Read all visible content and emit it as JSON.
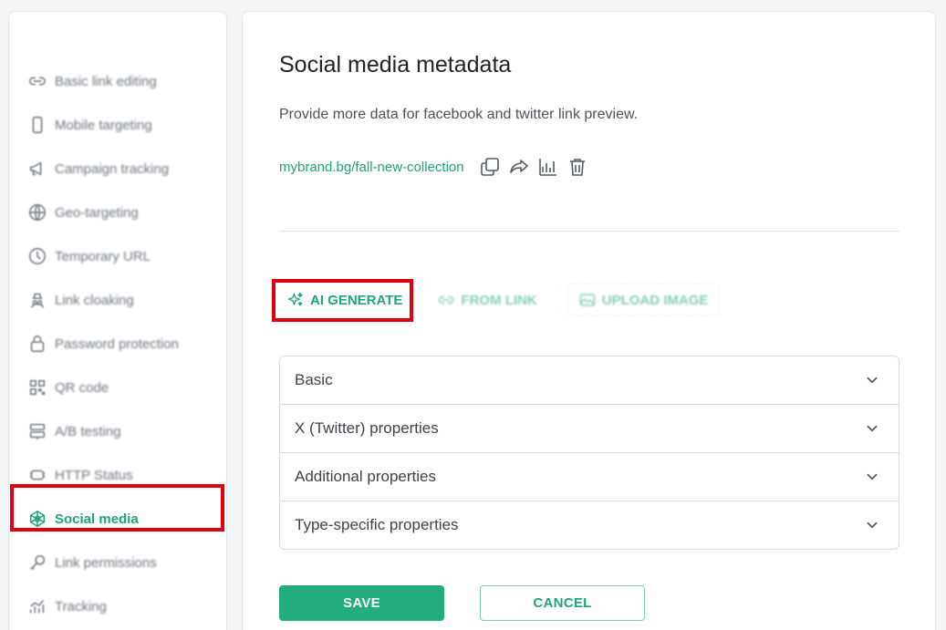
{
  "sidebar": {
    "items": [
      {
        "label": "Basic link editing",
        "icon": "link-icon"
      },
      {
        "label": "Mobile targeting",
        "icon": "mobile-icon"
      },
      {
        "label": "Campaign tracking",
        "icon": "megaphone-icon"
      },
      {
        "label": "Geo-targeting",
        "icon": "globe-icon"
      },
      {
        "label": "Temporary URL",
        "icon": "clock-icon"
      },
      {
        "label": "Link cloaking",
        "icon": "spy-icon"
      },
      {
        "label": "Password protection",
        "icon": "lock-icon"
      },
      {
        "label": "QR code",
        "icon": "qr-icon"
      },
      {
        "label": "A/B testing",
        "icon": "split-icon"
      },
      {
        "label": "HTTP Status",
        "icon": "status-icon"
      },
      {
        "label": "Social media",
        "icon": "social-icon",
        "active": true
      },
      {
        "label": "Link permissions",
        "icon": "key-icon"
      },
      {
        "label": "Tracking",
        "icon": "tracking-icon"
      }
    ]
  },
  "main": {
    "title": "Social media metadata",
    "subtitle": "Provide more data for facebook and twitter link preview.",
    "short_link": "mybrand.bg/fall-new-collection",
    "sources": {
      "ai_generate": "AI GENERATE",
      "from_link": "FROM LINK",
      "upload_image": "UPLOAD IMAGE"
    },
    "sections": [
      "Basic",
      "X (Twitter) properties",
      "Additional properties",
      "Type-specific properties"
    ],
    "save_label": "SAVE",
    "cancel_label": "CANCEL"
  },
  "colors": {
    "accent": "#1fa37a",
    "save_bg": "#23ad7f",
    "highlight": "#e2000f"
  }
}
